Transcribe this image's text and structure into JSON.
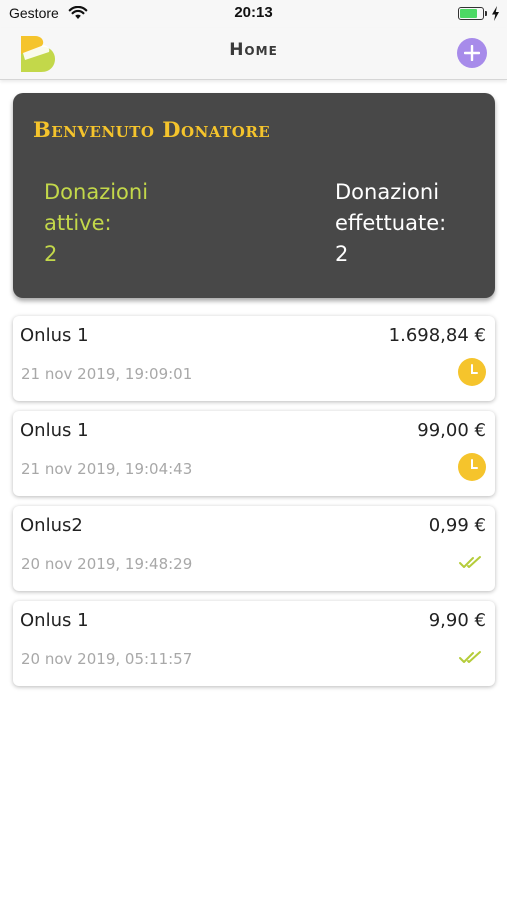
{
  "status_bar": {
    "carrier": "Gestore",
    "time": "20:13"
  },
  "nav": {
    "title": "Home",
    "add_icon": "plus-icon",
    "logo_icon": "app-logo-icon"
  },
  "welcome": {
    "title": "Benvenuto Donatore",
    "active_label": "Donazioni attive:",
    "active_value": "2",
    "done_label": "Donazioni effettuate:",
    "done_value": "2"
  },
  "donations": [
    {
      "name": "Onlus 1",
      "amount": "1.698,84 €",
      "date": "21 nov 2019, 19:09:01",
      "status": "pending",
      "status_icon": "clock-icon"
    },
    {
      "name": "Onlus 1",
      "amount": "99,00 €",
      "date": "21 nov 2019, 19:04:43",
      "status": "pending",
      "status_icon": "clock-icon"
    },
    {
      "name": "Onlus2",
      "amount": "0,99 €",
      "date": "20 nov 2019, 19:48:29",
      "status": "completed",
      "status_icon": "double-check-icon"
    },
    {
      "name": "Onlus 1",
      "amount": "9,90 €",
      "date": "20 nov 2019, 05:11:57",
      "status": "completed",
      "status_icon": "double-check-icon"
    }
  ],
  "colors": {
    "accent_yellow": "#f5c42c",
    "accent_green": "#c3d84a",
    "card_dark": "#484848",
    "add_button": "#a78bea",
    "pending": "#f5c42c",
    "completed": "#b5cc3a"
  }
}
